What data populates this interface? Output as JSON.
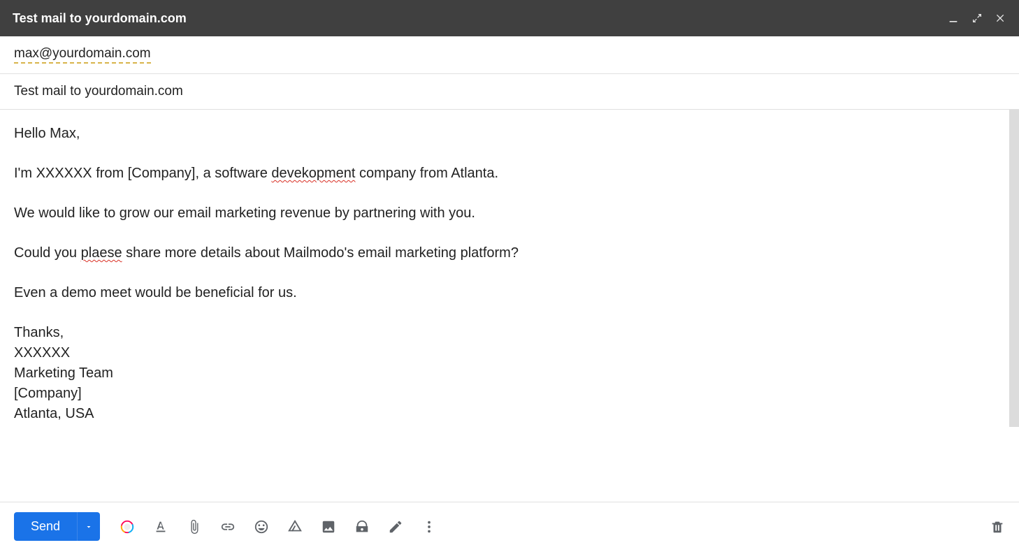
{
  "header": {
    "title": "Test mail to yourdomain.com"
  },
  "fields": {
    "to": "max@yourdomain.com",
    "subject": "Test mail to yourdomain.com"
  },
  "body": {
    "greeting": "Hello Max,",
    "p1_a": "I'm XXXXXX from [Company], a software ",
    "p1_err": "devekopment",
    "p1_b": " company from Atlanta.",
    "p2": "We would like to grow our email marketing revenue by partnering with you.",
    "p3_a": "Could you ",
    "p3_err": "plaese",
    "p3_b": " share more details about Mailmodo's email marketing platform?",
    "p4": "Even a demo meet would be beneficial for us.",
    "sig": "Thanks,\nXXXXXX\nMarketing Team\n[Company]\nAtlanta, USA"
  },
  "toolbar": {
    "send_label": "Send"
  }
}
